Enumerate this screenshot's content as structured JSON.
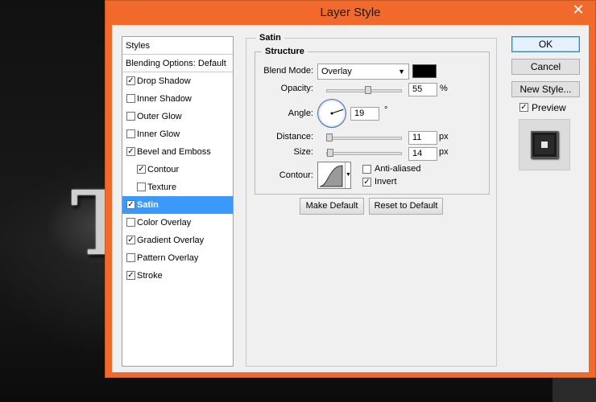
{
  "dialog": {
    "title": "Layer Style",
    "close_glyph": "✕"
  },
  "styles_panel": {
    "header": "Styles",
    "blending_options": "Blending Options: Default",
    "items": [
      {
        "label": "Drop Shadow",
        "checked": true,
        "sub": false,
        "selected": false
      },
      {
        "label": "Inner Shadow",
        "checked": false,
        "sub": false,
        "selected": false
      },
      {
        "label": "Outer Glow",
        "checked": false,
        "sub": false,
        "selected": false
      },
      {
        "label": "Inner Glow",
        "checked": false,
        "sub": false,
        "selected": false
      },
      {
        "label": "Bevel and Emboss",
        "checked": true,
        "sub": false,
        "selected": false
      },
      {
        "label": "Contour",
        "checked": true,
        "sub": true,
        "selected": false
      },
      {
        "label": "Texture",
        "checked": false,
        "sub": true,
        "selected": false
      },
      {
        "label": "Satin",
        "checked": true,
        "sub": false,
        "selected": true
      },
      {
        "label": "Color Overlay",
        "checked": false,
        "sub": false,
        "selected": false
      },
      {
        "label": "Gradient Overlay",
        "checked": true,
        "sub": false,
        "selected": false
      },
      {
        "label": "Pattern Overlay",
        "checked": false,
        "sub": false,
        "selected": false
      },
      {
        "label": "Stroke",
        "checked": true,
        "sub": false,
        "selected": false
      }
    ]
  },
  "satin": {
    "group_title": "Satin",
    "structure_title": "Structure",
    "blend_mode_label": "Blend Mode:",
    "blend_mode_value": "Overlay",
    "blend_color": "#000000",
    "opacity_label": "Opacity:",
    "opacity_value": "55",
    "opacity_unit": "%",
    "opacity_fraction": 0.55,
    "angle_label": "Angle:",
    "angle_value": "19",
    "angle_unit": "°",
    "distance_label": "Distance:",
    "distance_value": "11",
    "distance_unit": "px",
    "distance_fraction": 0.04,
    "size_label": "Size:",
    "size_value": "14",
    "size_unit": "px",
    "size_fraction": 0.05,
    "contour_label": "Contour:",
    "anti_aliased_label": "Anti-aliased",
    "anti_aliased_checked": false,
    "invert_label": "Invert",
    "invert_checked": true,
    "make_default_label": "Make Default",
    "reset_default_label": "Reset to Default"
  },
  "side_buttons": {
    "ok_label": "OK",
    "cancel_label": "Cancel",
    "new_style_label": "New Style...",
    "preview_label": "Preview",
    "preview_checked": true
  }
}
